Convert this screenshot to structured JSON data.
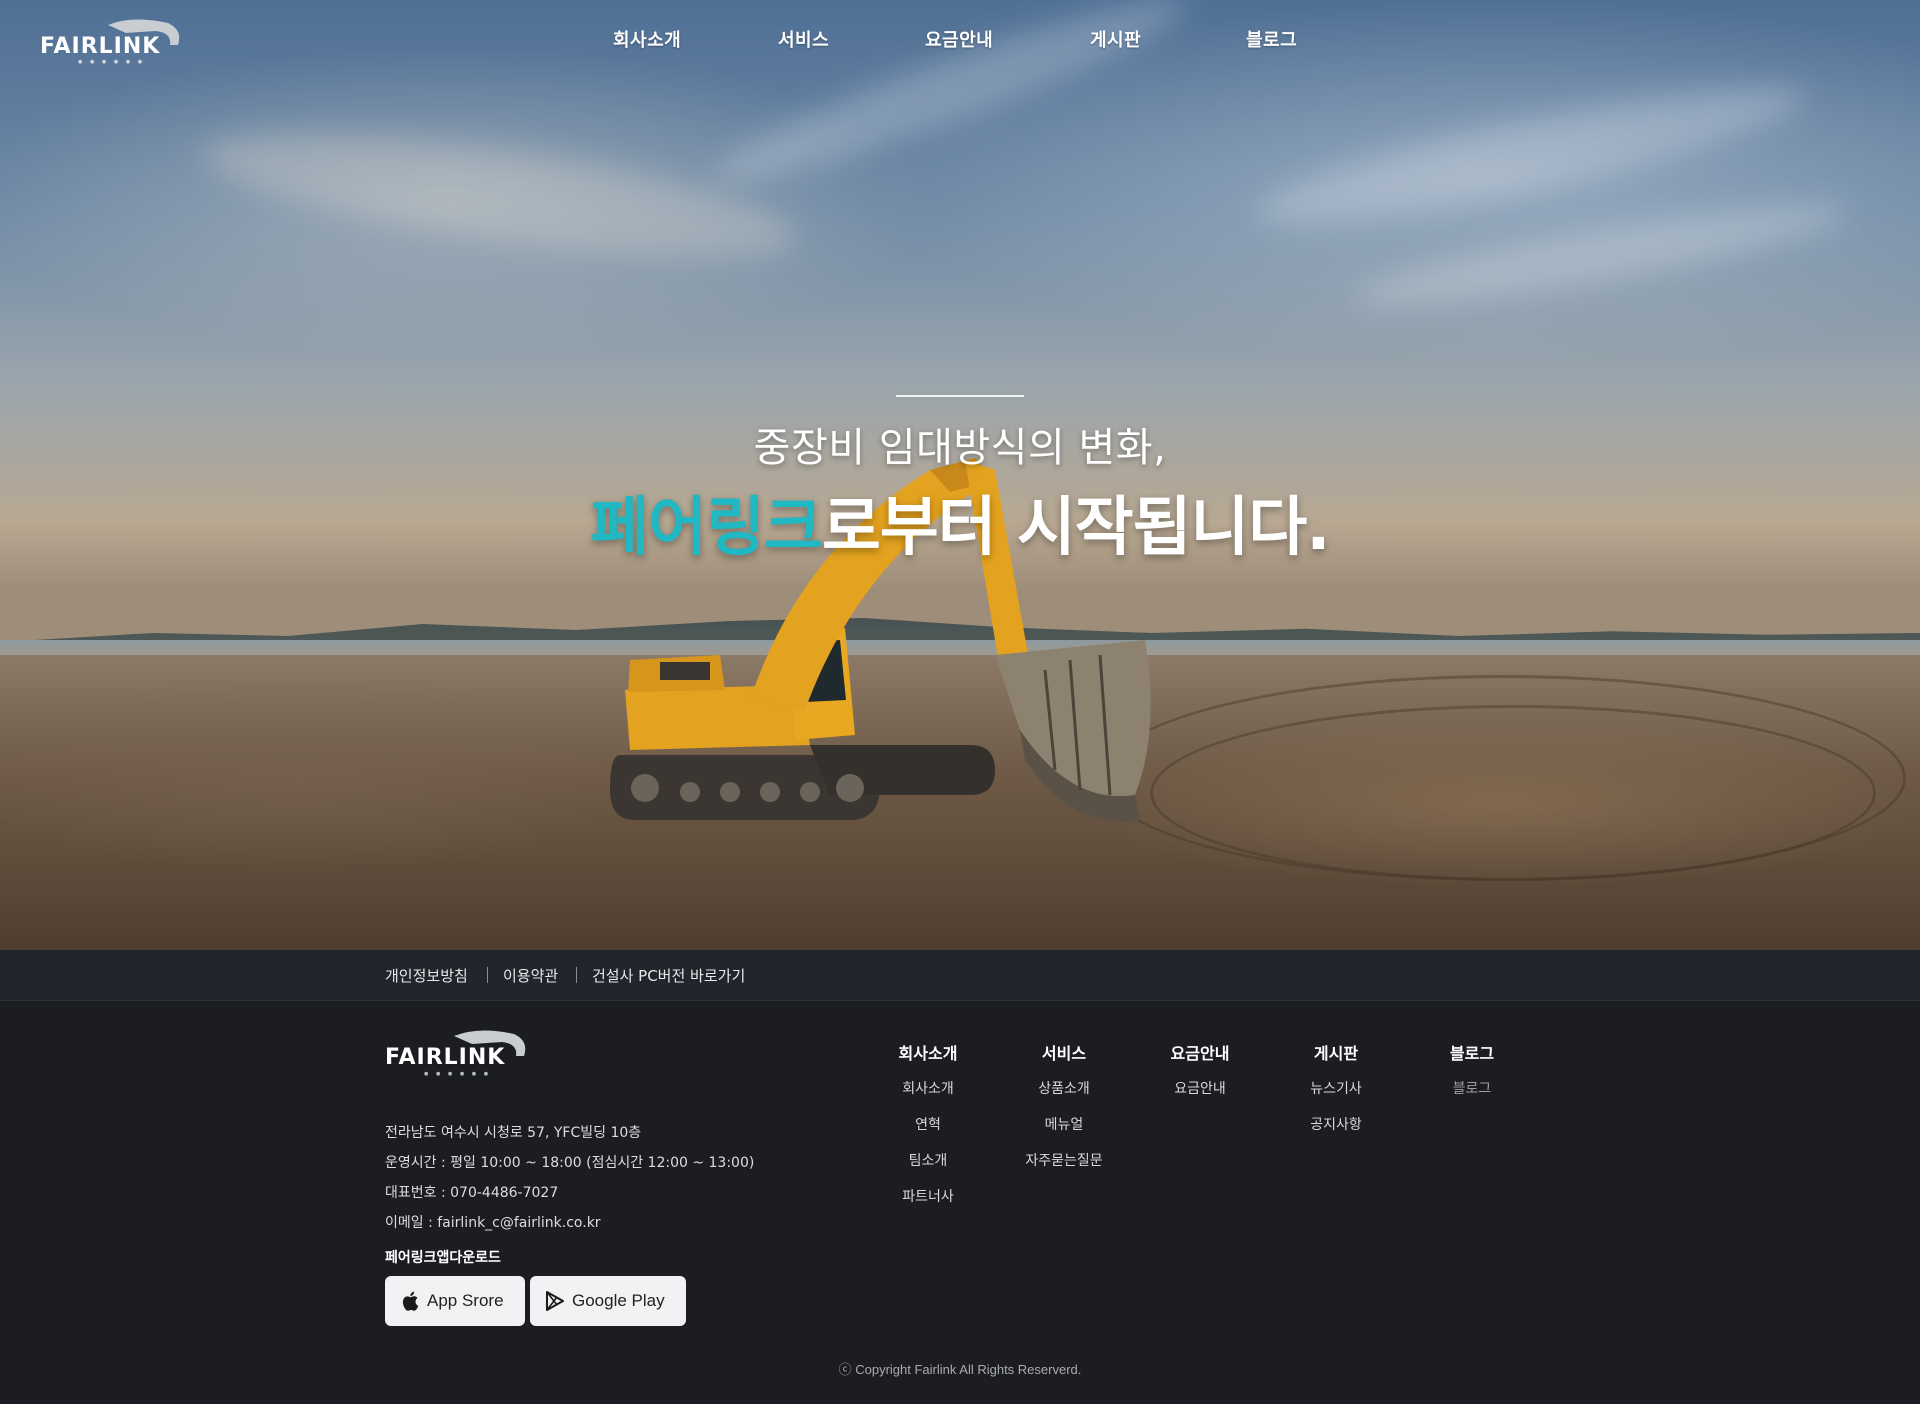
{
  "header": {
    "logo_text": "FAIRLINK",
    "nav": [
      "회사소개",
      "서비스",
      "요금안내",
      "게시판",
      "블로그"
    ]
  },
  "hero": {
    "subtitle": "중장비 임대방식의 변화,",
    "title_accent": "페어링크",
    "title_rest": "로부터 시작됩니다."
  },
  "footer": {
    "links": [
      "개인정보방침",
      "이용약관",
      "건설사 PC버전 바로가기"
    ],
    "logo_text": "FAIRLINK",
    "address": "전라남도 여수시 시청로 57, YFC빌딩 10층",
    "hours": "운영시간 : 평일 10:00 ~ 18:00 (점심시간 12:00 ~ 13:00)",
    "phone": "대표번호 : 070-4486-7027",
    "email": "이메일 : fairlink_c@fairlink.co.kr",
    "download_title": "페어링크앱다운로드",
    "app_store": "App Srore",
    "google_play": "Google Play",
    "columns": [
      {
        "head": "회사소개",
        "links": [
          "회사소개",
          "연혁",
          "팀소개",
          "파트너사"
        ]
      },
      {
        "head": "서비스",
        "links": [
          "상품소개",
          "메뉴얼",
          "자주묻는질문"
        ]
      },
      {
        "head": "요금안내",
        "links": [
          "요금안내"
        ]
      },
      {
        "head": "게시판",
        "links": [
          "뉴스기사",
          "공지사항"
        ]
      },
      {
        "head": "블로그",
        "links": [
          "블로그"
        ]
      }
    ],
    "copyright": "ⓒ  Copyright Fairlink All Rights Reserverd."
  },
  "colors": {
    "accent": "#1fb8c3",
    "footer_bg": "#1c1d22",
    "excavator": "#e3a21f"
  }
}
